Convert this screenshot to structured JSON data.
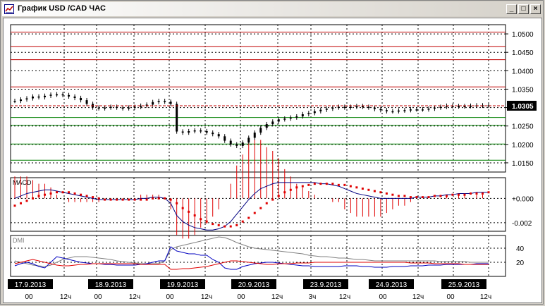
{
  "window": {
    "title": "График USD /CAD  ЧАС",
    "buttons": {
      "minimize": "_",
      "maximize": "□",
      "close": "×"
    }
  },
  "colors": {
    "background": "#ffffff",
    "grid": "#000000",
    "resistance": "#c00000",
    "support": "#008000",
    "candles": "#000000",
    "macd_line": "#000080",
    "macd_signal": "#e00000",
    "macd_hist": "#e00000",
    "dmi_adx": "#808080",
    "dmi_plus": "#0000c0",
    "dmi_minus": "#e00000",
    "price_label_bg": "#000000",
    "date_label_bg": "#000000"
  },
  "chart_data": [
    {
      "type": "candlestick",
      "panel": "price",
      "ylim": [
        1.0125,
        1.0525
      ],
      "y_ticks": [
        "1.0150",
        "1.0200",
        "1.0250",
        "1.0300",
        "1.0350",
        "1.0400",
        "1.0450",
        "1.0500"
      ],
      "last_price": "1.0305",
      "resistance_levels": [
        1.0356,
        1.043,
        1.0466,
        1.0505
      ],
      "support_levels": [
        1.0273,
        1.0252,
        1.0201,
        1.0157
      ],
      "series": [
        {
          "name": "",
          "values": [
            1.0318,
            1.0322,
            1.0325,
            1.033,
            1.0328,
            1.0332,
            1.0335,
            1.0336,
            1.0334,
            1.033,
            1.0326,
            1.032,
            1.031,
            1.03,
            1.0298,
            1.03,
            1.0302,
            1.03,
            1.0298,
            1.03,
            1.0302,
            1.0305,
            1.0308,
            1.0315,
            1.0318,
            1.0316,
            1.031,
            1.0235,
            1.0232,
            1.0236,
            1.0238,
            1.0236,
            1.0232,
            1.0228,
            1.0222,
            1.021,
            1.02,
            1.0196,
            1.0205,
            1.0218,
            1.0232,
            1.0245,
            1.0255,
            1.0262,
            1.0268,
            1.027,
            1.0273,
            1.0276,
            1.0282,
            1.0285,
            1.029,
            1.0294,
            1.0297,
            1.03,
            1.0302,
            1.03,
            1.0302,
            1.0304,
            1.0302,
            1.03,
            1.0296,
            1.0293,
            1.029,
            1.029,
            1.0292,
            1.0293,
            1.0295,
            1.0295,
            1.0295,
            1.0297,
            1.03,
            1.0302,
            1.0305,
            1.0304,
            1.0303,
            1.0304,
            1.0305,
            1.0306,
            1.0305,
            1.0306
          ]
        }
      ]
    },
    {
      "type": "line",
      "panel": "macd",
      "title": "MACD",
      "ylim": [
        -0.0027,
        0.0017
      ],
      "y_ticks": [
        "+0.000",
        "-0.002"
      ],
      "series": [
        {
          "name": "",
          "values": [
            0.0,
            0.0002,
            0.0004,
            0.0005,
            0.0006,
            0.0007,
            0.0007,
            0.0006,
            0.0005,
            0.0004,
            0.0003,
            0.0002,
            0.0001,
            0.0,
            -0.0001,
            -0.0001,
            -0.0001,
            -0.0001,
            -0.0001,
            -0.0001,
            -0.0001,
            0.0,
            0.0,
            0.0001,
            0.0001,
            0.0,
            -0.0004,
            -0.0014,
            -0.0019,
            -0.0022,
            -0.0024,
            -0.0025,
            -0.0026,
            -0.0026,
            -0.0025,
            -0.0023,
            -0.0019,
            -0.0013,
            -0.0007,
            -0.0001,
            0.0004,
            0.0008,
            0.001,
            0.0012,
            0.0013,
            0.0013,
            0.0013,
            0.0013,
            0.0013,
            0.0013,
            0.0013,
            0.0012,
            0.0012,
            0.0011,
            0.001,
            0.0008,
            0.0006,
            0.0004,
            0.0003,
            0.0002,
            0.0001,
            0.0,
            0.0,
            0.0,
            0.0,
            0.0,
            0.0,
            0.0001,
            0.0001,
            0.0001,
            0.0002,
            0.0002,
            0.0003,
            0.0003,
            0.0004,
            0.0004,
            0.0004,
            0.0005,
            0.0005,
            0.0005
          ]
        },
        {
          "name": "",
          "values": [
            -0.0006,
            -0.0004,
            -0.0002,
            0.0,
            0.0002,
            0.0003,
            0.0004,
            0.0005,
            0.0005,
            0.0005,
            0.0004,
            0.0003,
            0.0002,
            0.0001,
            0.0,
            -0.0001,
            -0.0001,
            -0.0001,
            -0.0001,
            -0.0001,
            -0.0001,
            -0.0001,
            -0.0001,
            0.0,
            0.0,
            0.0,
            -0.0001,
            -0.0004,
            -0.0008,
            -0.0011,
            -0.0014,
            -0.0017,
            -0.0019,
            -0.0021,
            -0.0022,
            -0.0023,
            -0.0023,
            -0.0022,
            -0.0019,
            -0.0016,
            -0.0012,
            -0.0008,
            -0.0004,
            -0.0001,
            0.0002,
            0.0005,
            0.0007,
            0.0009,
            0.001,
            0.0011,
            0.0012,
            0.0012,
            0.0012,
            0.0012,
            0.0011,
            0.0011,
            0.001,
            0.0009,
            0.0008,
            0.0007,
            0.0006,
            0.0005,
            0.0004,
            0.0003,
            0.0002,
            0.0002,
            0.0001,
            0.0001,
            0.0001,
            0.0001,
            0.0002,
            0.0002,
            0.0002,
            0.0003,
            0.0003,
            0.0003,
            0.0004,
            0.0004,
            0.0004,
            0.0005
          ]
        }
      ]
    },
    {
      "type": "line",
      "panel": "dmi",
      "title": "DMI",
      "ylim": [
        0,
        58
      ],
      "y_ticks": [
        "40",
        "20"
      ],
      "series": [
        {
          "name": "",
          "values": [
            22,
            20,
            18,
            16,
            15,
            14,
            16,
            20,
            24,
            26,
            28,
            28,
            28,
            27,
            26,
            25,
            24,
            22,
            21,
            20,
            19,
            18,
            18,
            18,
            18,
            22,
            38,
            42,
            44,
            46,
            48,
            50,
            52,
            54,
            56,
            55,
            52,
            48,
            45,
            42,
            40,
            39,
            38,
            37,
            36,
            35,
            34,
            33,
            32,
            30,
            29,
            28,
            28,
            27,
            26,
            26,
            25,
            24,
            24,
            23,
            22,
            22,
            22,
            22,
            22,
            22,
            22,
            22,
            22,
            22,
            22,
            21,
            21,
            21,
            21,
            21,
            20,
            20,
            20,
            20
          ]
        },
        {
          "name": "",
          "values": [
            15,
            18,
            20,
            18,
            14,
            12,
            20,
            28,
            26,
            24,
            22,
            20,
            19,
            18,
            18,
            17,
            17,
            16,
            16,
            16,
            16,
            17,
            18,
            20,
            22,
            22,
            42,
            36,
            34,
            32,
            32,
            30,
            30,
            24,
            20,
            12,
            10,
            10,
            14,
            16,
            18,
            19,
            20,
            20,
            19,
            18,
            17,
            16,
            15,
            15,
            14,
            14,
            14,
            14,
            14,
            15,
            15,
            15,
            14,
            14,
            13,
            13,
            13,
            14,
            14,
            14,
            15,
            15,
            15,
            16,
            16,
            16,
            17,
            17,
            17,
            17,
            17,
            18,
            18,
            18
          ]
        },
        {
          "name": "",
          "values": [
            18,
            20,
            22,
            24,
            22,
            20,
            18,
            16,
            15,
            15,
            16,
            17,
            17,
            18,
            18,
            18,
            18,
            18,
            18,
            18,
            18,
            17,
            17,
            17,
            17,
            17,
            10,
            10,
            11,
            11,
            12,
            13,
            14,
            16,
            18,
            20,
            22,
            22,
            21,
            20,
            19,
            18,
            17,
            17,
            18,
            18,
            18,
            19,
            19,
            19,
            20,
            20,
            20,
            20,
            20,
            20,
            20,
            20,
            20,
            20,
            20,
            20,
            20,
            20,
            20,
            20,
            19,
            19,
            19,
            19,
            18,
            18,
            18,
            18,
            18,
            17,
            17,
            17,
            17,
            17
          ]
        }
      ]
    }
  ],
  "x_axis": {
    "dates": [
      "17.9.2013",
      "18.9.2013",
      "19.9.2013",
      "20.9.2013",
      "23.9.2013",
      "24.9.2013",
      "25.9.2013"
    ],
    "hour_labels": [
      "00",
      "12ч",
      "00",
      "12ч",
      "00",
      "12ч",
      "00",
      "12ч",
      "3ч",
      "12ч",
      "00",
      "12ч",
      "00",
      "12ч"
    ]
  }
}
